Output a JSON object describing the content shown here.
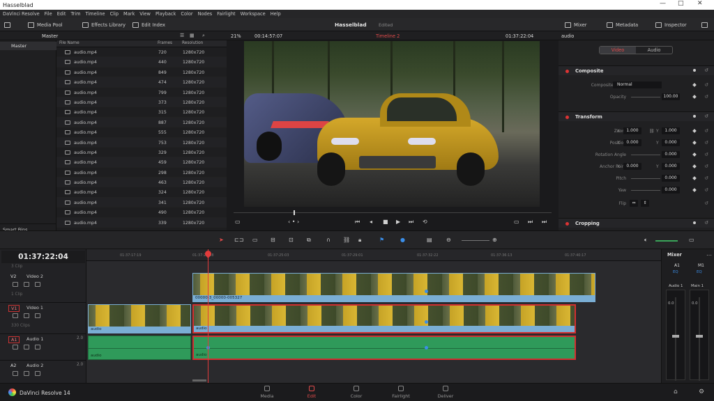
{
  "window": {
    "title": "Hasselblad",
    "controls": [
      "—",
      "□",
      "✕"
    ]
  },
  "menu": [
    "DaVinci Resolve",
    "File",
    "Edit",
    "Trim",
    "Timeline",
    "Clip",
    "Mark",
    "View",
    "Playback",
    "Color",
    "Nodes",
    "Fairlight",
    "Workspace",
    "Help"
  ],
  "toolbar": {
    "media_pool": "Media Pool",
    "effects_library": "Effects Library",
    "edit_index": "Edit Index",
    "project_name": "Hasselblad",
    "project_status": "Edited",
    "mixer": "Mixer",
    "metadata": "Metadata",
    "inspector": "Inspector"
  },
  "media_pool": {
    "folder": "Master",
    "bins": {
      "master": "Master",
      "smart_bins": "Smart Bins"
    },
    "columns": [
      "File Name",
      "Frames",
      "Resolution"
    ],
    "files": [
      {
        "name": "audio.mp4",
        "frames": "720",
        "res": "1280x720"
      },
      {
        "name": "audio.mp4",
        "frames": "440",
        "res": "1280x720"
      },
      {
        "name": "audio.mp4",
        "frames": "849",
        "res": "1280x720"
      },
      {
        "name": "audio.mp4",
        "frames": "474",
        "res": "1280x720"
      },
      {
        "name": "audio.mp4",
        "frames": "799",
        "res": "1280x720"
      },
      {
        "name": "audio.mp4",
        "frames": "373",
        "res": "1280x720"
      },
      {
        "name": "audio.mp4",
        "frames": "315",
        "res": "1280x720"
      },
      {
        "name": "audio.mp4",
        "frames": "887",
        "res": "1280x720"
      },
      {
        "name": "audio.mp4",
        "frames": "555",
        "res": "1280x720"
      },
      {
        "name": "audio.mp4",
        "frames": "753",
        "res": "1280x720"
      },
      {
        "name": "audio.mp4",
        "frames": "329",
        "res": "1280x720"
      },
      {
        "name": "audio.mp4",
        "frames": "459",
        "res": "1280x720"
      },
      {
        "name": "audio.mp4",
        "frames": "298",
        "res": "1280x720"
      },
      {
        "name": "audio.mp4",
        "frames": "463",
        "res": "1280x720"
      },
      {
        "name": "audio.mp4",
        "frames": "324",
        "res": "1280x720"
      },
      {
        "name": "audio.mp4",
        "frames": "341",
        "res": "1280x720"
      },
      {
        "name": "audio.mp4",
        "frames": "490",
        "res": "1280x720"
      },
      {
        "name": "audio.mp4",
        "frames": "339",
        "res": "1280x720"
      }
    ]
  },
  "viewer": {
    "zoom": "21%",
    "source_timecode": "00:14:57:07",
    "timeline_name": "Timeline 2",
    "record_timecode": "01:37:22:04",
    "clip_name": "audio"
  },
  "inspector": {
    "tabs": [
      "Video",
      "Audio"
    ],
    "composite": {
      "title": "Composite",
      "mode_label": "Composite Mode",
      "mode_value": "Normal",
      "opacity_label": "Opacity",
      "opacity_value": "100.00"
    },
    "transform": {
      "title": "Transform",
      "zoom_label": "Zoom",
      "zoom_x": "1.000",
      "zoom_y": "1.000",
      "position_label": "Position",
      "position_x": "0.000",
      "position_y": "0.000",
      "rotation_label": "Rotation Angle",
      "rotation_value": "0.000",
      "anchor_label": "Anchor Point",
      "anchor_x": "0.000",
      "anchor_y": "0.000",
      "pitch_label": "Pitch",
      "pitch_value": "0.000",
      "yaw_label": "Yaw",
      "yaw_value": "0.000",
      "flip_label": "Flip",
      "x": "X",
      "y": "Y"
    },
    "cropping": {
      "title": "Cropping"
    }
  },
  "timeline": {
    "timecode": "01:37:22:04",
    "ruler": [
      "01:37:17:19",
      "01:37:21:08",
      "01:37:25:03",
      "01:37:29:01",
      "01:37:32:22",
      "01:37:36:13",
      "01:37:40:17"
    ],
    "tracks": [
      {
        "id": "V2",
        "name": "Video 2",
        "sub": "1 Clip"
      },
      {
        "id": "V1",
        "name": "Video 1",
        "sub": "330 Clips"
      },
      {
        "id": "A1",
        "name": "Audio 1",
        "level": "2.0"
      },
      {
        "id": "A2",
        "name": "Audio 2",
        "level": "2.0"
      }
    ],
    "top_track_sub": "3 Clip",
    "clip_label_v2": "00000-3_00000-005327",
    "clip_label_audio": "audio"
  },
  "mixer": {
    "title": "Mixer",
    "channels": [
      "A1",
      "M1"
    ],
    "channel_names": [
      "Audio 1",
      "Main 1"
    ],
    "eq": "EQ",
    "level": "0.0"
  },
  "pages": [
    "Media",
    "Edit",
    "Color",
    "Fairlight",
    "Deliver"
  ],
  "app_name": "DaVinci Resolve 14"
}
